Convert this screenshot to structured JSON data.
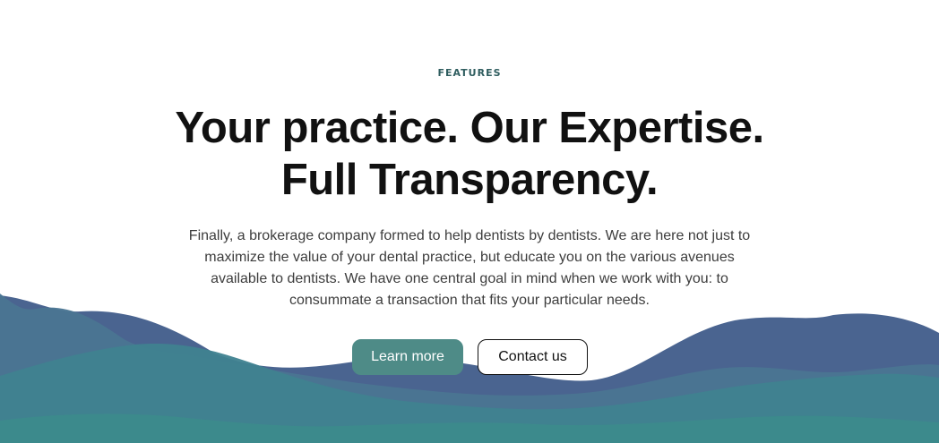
{
  "section": {
    "eyebrow": "FEATURES",
    "headline_line1": "Your practice. Our Expertise.",
    "headline_line2": "Full Transparency.",
    "description": "Finally, a brokerage company formed to help dentists by dentists. We are here not just to maximize the value of your dental practice, but educate you on the various avenues available to dentists. We have one central goal in mind when we work with you: to consummate a transaction that fits your particular needs."
  },
  "buttons": {
    "primary_label": "Learn more",
    "secondary_label": "Contact us"
  },
  "colors": {
    "accent": "#4e8b87",
    "eyebrow": "#2f5d5f",
    "wave_dark": "#4a6490",
    "wave_mid": "#4a7592",
    "wave_teal": "#3f8290",
    "wave_light": "#3c8a8c"
  }
}
